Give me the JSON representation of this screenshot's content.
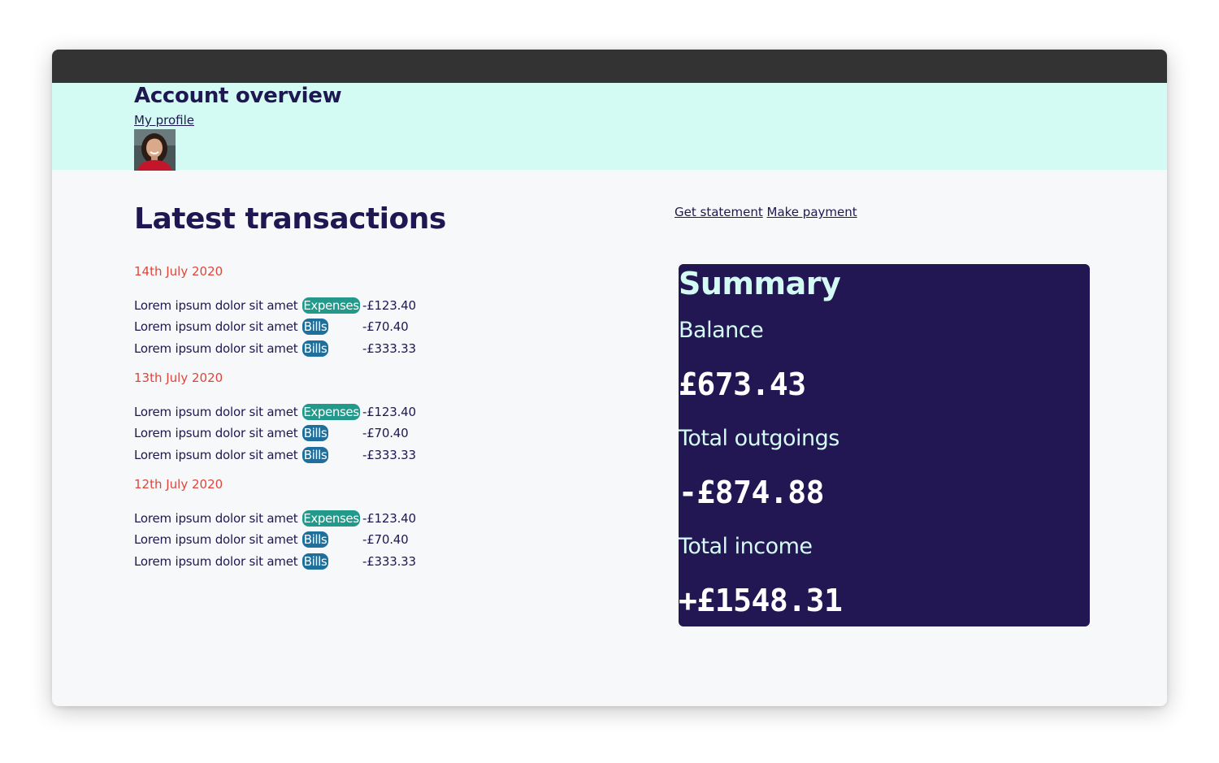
{
  "header": {
    "title": "Account overview",
    "profile_link": "My profile"
  },
  "main": {
    "title": "Latest transactions",
    "actions": {
      "statement": "Get statement",
      "payment": "Make payment"
    },
    "groups": [
      {
        "date": "14th July 2020",
        "transactions": [
          {
            "description": "Lorem ipsum dolor sit amet",
            "category": "Expenses",
            "amount": "-£123.40"
          },
          {
            "description": "Lorem ipsum dolor sit amet",
            "category": "Bills",
            "amount": "-£70.40"
          },
          {
            "description": "Lorem ipsum dolor sit amet",
            "category": "Bills",
            "amount": "-£333.33"
          }
        ]
      },
      {
        "date": "13th July 2020",
        "transactions": [
          {
            "description": "Lorem ipsum dolor sit amet",
            "category": "Expenses",
            "amount": "-£123.40"
          },
          {
            "description": "Lorem ipsum dolor sit amet",
            "category": "Bills",
            "amount": "-£70.40"
          },
          {
            "description": "Lorem ipsum dolor sit amet",
            "category": "Bills",
            "amount": "-£333.33"
          }
        ]
      },
      {
        "date": "12th July 2020",
        "transactions": [
          {
            "description": "Lorem ipsum dolor sit amet",
            "category": "Expenses",
            "amount": "-£123.40"
          },
          {
            "description": "Lorem ipsum dolor sit amet",
            "category": "Bills",
            "amount": "-£70.40"
          },
          {
            "description": "Lorem ipsum dolor sit amet",
            "category": "Bills",
            "amount": "-£333.33"
          }
        ]
      }
    ]
  },
  "summary": {
    "title": "Summary",
    "balance_label": "Balance",
    "balance_value": "£673.43",
    "outgoings_label": "Total outgoings",
    "outgoings_value": "-£874.88",
    "income_label": "Total income",
    "income_value": "+£1548.31"
  },
  "colors": {
    "primary": "#1f1752",
    "header_bg": "#d4fbf3",
    "date": "#e0453a",
    "expenses_tag": "#22998a",
    "bills_tag": "#1f6f9c",
    "summary_bg": "#221752"
  }
}
